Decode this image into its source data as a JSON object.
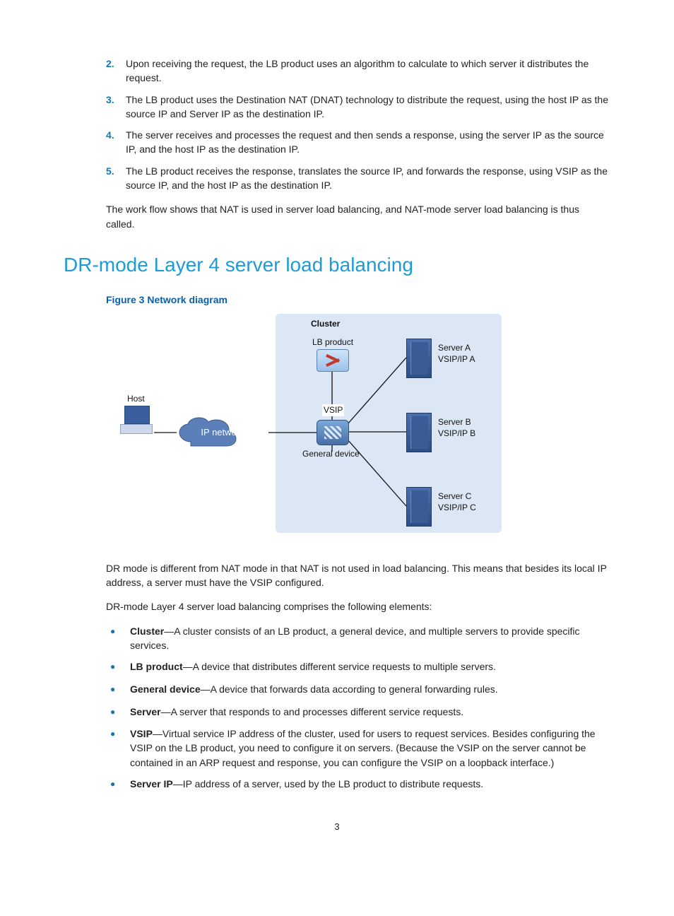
{
  "numbered": [
    {
      "n": "2.",
      "t": "Upon receiving the request, the LB product uses an algorithm to calculate to which server it distributes the request."
    },
    {
      "n": "3.",
      "t": "The LB product uses the Destination NAT (DNAT) technology to distribute the request, using the host IP as the source IP and Server IP as the destination IP."
    },
    {
      "n": "4.",
      "t": "The server receives and processes the request and then sends a response, using the server IP as the source IP, and the host IP as the destination IP."
    },
    {
      "n": "5.",
      "t": "The LB product receives the response, translates the source IP, and forwards the response, using VSIP as the source IP, and the host IP as the destination IP."
    }
  ],
  "para_after_numbered": "The work flow shows that NAT is used in server load balancing, and NAT-mode server load balancing is thus called.",
  "section_heading": "DR-mode Layer 4 server load balancing",
  "figure_caption": "Figure 3 Network diagram",
  "diagram": {
    "cluster": "Cluster",
    "lb_product": "LB product",
    "vsip": "VSIP",
    "general_device": "General device",
    "host": "Host",
    "ip_network": "IP network",
    "serverA_name": "Server A",
    "serverA_ip": "VSIP/IP A",
    "serverB_name": "Server B",
    "serverB_ip": "VSIP/IP B",
    "serverC_name": "Server C",
    "serverC_ip": "VSIP/IP C"
  },
  "para_dr_intro": "DR mode is different from NAT mode in that NAT is not used in load balancing. This means that besides its local IP address, a server must have the VSIP configured.",
  "para_dr_comprises": "DR-mode Layer 4 server load balancing comprises the following elements:",
  "bullets": [
    {
      "term": "Cluster",
      "desc": "—A cluster consists of an LB product, a general device, and multiple servers to provide specific services."
    },
    {
      "term": "LB product",
      "desc": "—A device that distributes different service requests to multiple servers."
    },
    {
      "term": "General device",
      "desc": "—A device that forwards data according to general forwarding rules."
    },
    {
      "term": "Server",
      "desc": "—A server that responds to and processes different service requests."
    },
    {
      "term": "VSIP",
      "desc": "—Virtual service IP address of the cluster, used for users to request services. Besides configuring the VSIP on the LB product, you need to configure it on servers. (Because the VSIP on the server cannot be contained in an ARP request and response, you can configure the VSIP on a loopback interface.)"
    },
    {
      "term": "Server IP",
      "desc": "—IP address of a server, used by the LB product to distribute requests."
    }
  ],
  "page_number": "3"
}
